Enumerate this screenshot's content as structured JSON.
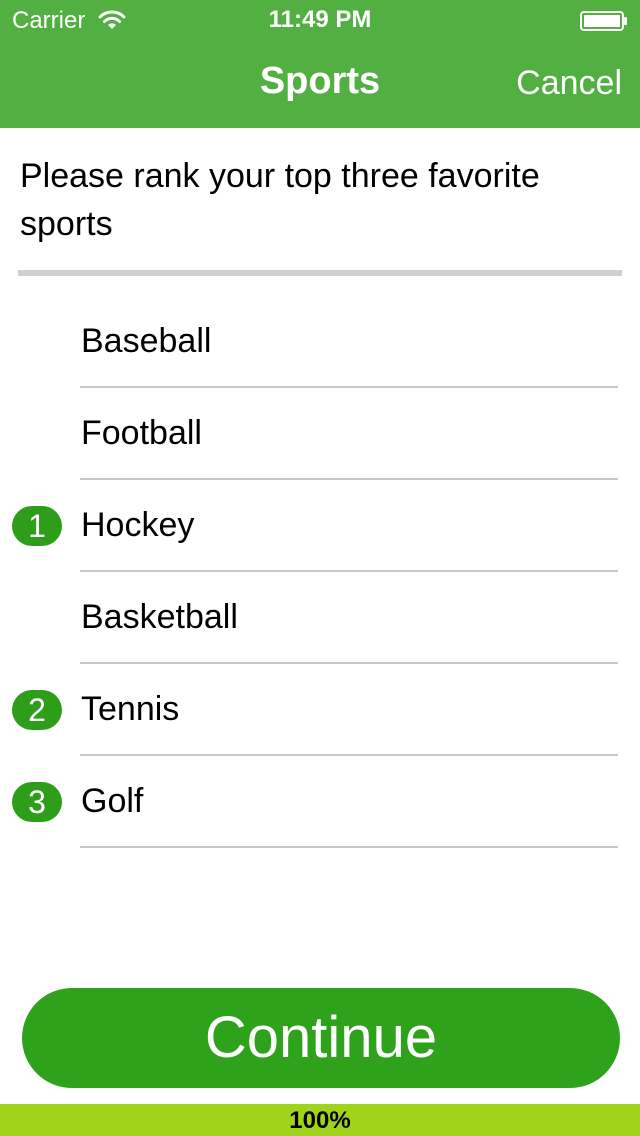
{
  "status_bar": {
    "carrier": "Carrier",
    "time": "11:49 PM"
  },
  "nav": {
    "title": "Sports",
    "cancel_label": "Cancel"
  },
  "question": {
    "text": "Please rank your top three favorite sports"
  },
  "options": [
    {
      "label": "Baseball",
      "rank": ""
    },
    {
      "label": "Football",
      "rank": ""
    },
    {
      "label": "Hockey",
      "rank": "1"
    },
    {
      "label": "Basketball",
      "rank": ""
    },
    {
      "label": "Tennis",
      "rank": "2"
    },
    {
      "label": "Golf",
      "rank": "3"
    }
  ],
  "continue_label": "Continue",
  "progress": {
    "percent": 100,
    "label": "100%"
  },
  "icons": {
    "wifi": "wifi-icon",
    "battery": "battery-icon"
  },
  "colors": {
    "header": "#52b043",
    "accent": "#2ea21b",
    "rank_badge": "#2e9e1a",
    "progress": "#a0d41b"
  }
}
